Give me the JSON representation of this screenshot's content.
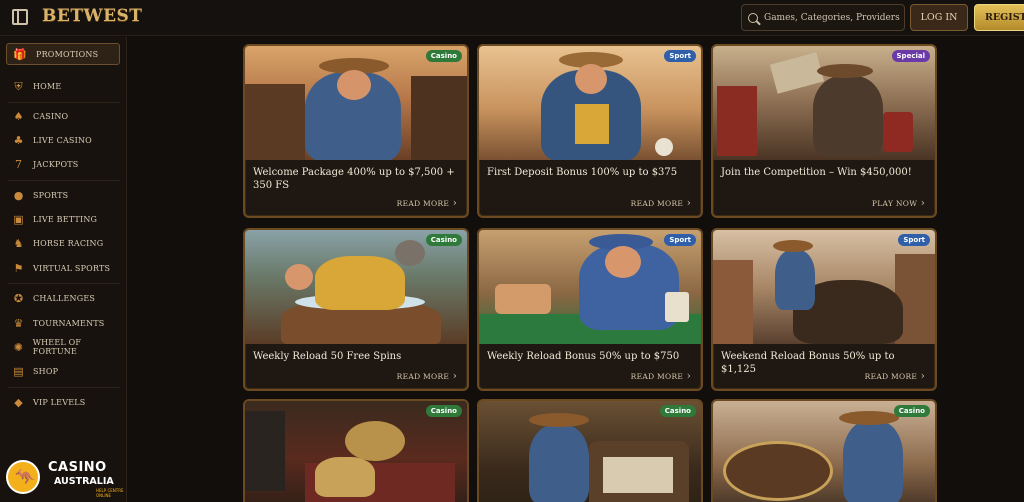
{
  "header": {
    "logo": "BETWEST",
    "search_placeholder": "Games, Categories, Providers",
    "login": "LOG IN",
    "register": "REGISTER"
  },
  "sidebar": {
    "promotions": "PROMOTIONS",
    "items": [
      {
        "label": "HOME",
        "icon": "shield-icon"
      },
      {
        "label": "CASINO",
        "icon": "cards-icon"
      },
      {
        "label": "LIVE CASINO",
        "icon": "dealer-icon"
      },
      {
        "label": "JACKPOTS",
        "icon": "slot-icon"
      },
      {
        "label": "SPORTS",
        "icon": "ball-icon"
      },
      {
        "label": "LIVE BETTING",
        "icon": "live-icon"
      },
      {
        "label": "HORSE RACING",
        "icon": "horse-icon"
      },
      {
        "label": "VIRTUAL SPORTS",
        "icon": "virtual-icon"
      },
      {
        "label": "CHALLENGES",
        "icon": "medal-icon"
      },
      {
        "label": "TOURNAMENTS",
        "icon": "trophy-icon"
      },
      {
        "label": "WHEEL OF FORTUNE",
        "icon": "wheel-icon"
      },
      {
        "label": "SHOP",
        "icon": "shop-icon"
      },
      {
        "label": "VIP LEVELS",
        "icon": "diamond-icon"
      }
    ]
  },
  "cards": [
    {
      "badge": "Casino",
      "title": "Welcome Package 400% up to $7,500 + 350 FS",
      "cta": "READ MORE"
    },
    {
      "badge": "Sport",
      "title": "First Deposit Bonus 100% up to $375",
      "cta": "READ MORE"
    },
    {
      "badge": "Special",
      "title": "Join the Competition – Win $450,000!",
      "cta": "PLAY NOW"
    },
    {
      "badge": "Casino",
      "title": "Weekly Reload 50 Free Spins",
      "cta": "READ MORE"
    },
    {
      "badge": "Sport",
      "title": "Weekly Reload Bonus 50% up to $750",
      "cta": "READ MORE"
    },
    {
      "badge": "Sport",
      "title": "Weekend Reload Bonus 50% up to $1,125",
      "cta": "READ MORE"
    },
    {
      "badge": "Casino",
      "title": "",
      "cta": ""
    },
    {
      "badge": "Casino",
      "title": "",
      "cta": ""
    },
    {
      "badge": "Casino",
      "title": "",
      "cta": ""
    }
  ],
  "watermark": {
    "line1": "CASINO",
    "line2": "AUSTRALIA",
    "line3": "HELP CENTRE ONLINE"
  }
}
